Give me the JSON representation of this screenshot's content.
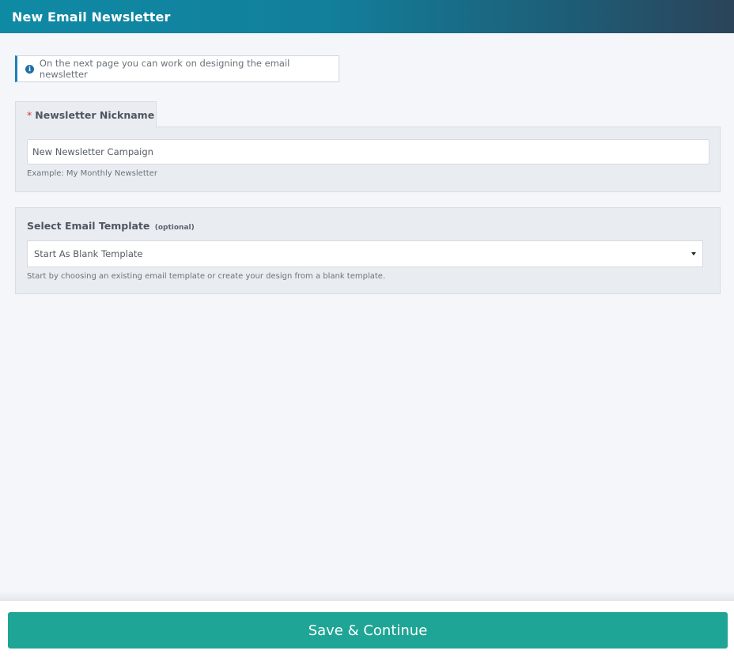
{
  "header": {
    "title": "New Email Newsletter"
  },
  "notice": {
    "text": "On the next page you can work on designing the email newsletter",
    "icon": "info-icon"
  },
  "nickname": {
    "required_marker": "*",
    "label": "Newsletter Nickname",
    "value": "New Newsletter Campaign",
    "hint": "Example: My Monthly Newsletter"
  },
  "template": {
    "label": "Select Email Template",
    "optional_label": "(optional)",
    "selected": "Start As Blank Template",
    "hint": "Start by choosing an existing email template or create your design from a blank template."
  },
  "footer": {
    "save_label": "Save & Continue"
  },
  "colors": {
    "accent": "#1fa595",
    "header_start": "#0f8aa5",
    "header_end": "#2b4459",
    "info": "#1f7fb8",
    "required": "#e0343a"
  }
}
